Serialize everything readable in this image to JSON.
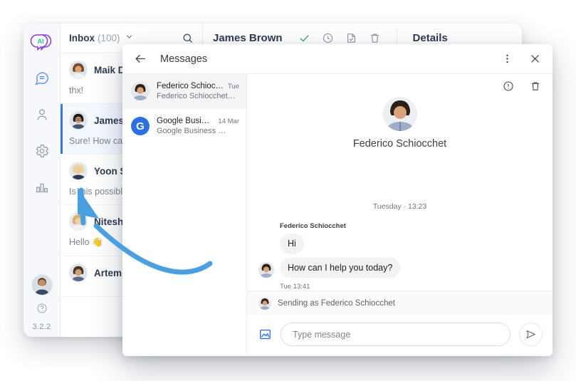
{
  "app": {
    "version_label": "3.2.2",
    "logo_text": "AI",
    "rail_items": [
      {
        "name": "conversations",
        "icon": "chat-icon"
      },
      {
        "name": "contacts",
        "icon": "person-icon"
      },
      {
        "name": "settings",
        "icon": "gear-icon"
      },
      {
        "name": "reports",
        "icon": "bar-chart-icon"
      }
    ]
  },
  "inbox": {
    "label": "Inbox",
    "count": "(100)",
    "search_icon": "search-icon",
    "chevron_icon": "chevron-down-icon",
    "conversations": [
      {
        "name": "Maik Da",
        "preview": "thx!"
      },
      {
        "name": "James B",
        "preview": "Sure! How can I h"
      },
      {
        "name": "Yoon Ss",
        "preview": "Is this possible?"
      },
      {
        "name": "Nitesh S",
        "preview": "Hello 👋"
      },
      {
        "name": "Artem P",
        "preview": ""
      }
    ]
  },
  "conversation_header": {
    "title": "James Brown",
    "details_label": "Details",
    "actions": [
      {
        "name": "resolve-check",
        "icon": "check-icon",
        "color": "#4eab6e"
      },
      {
        "name": "snooze",
        "icon": "clock-icon"
      },
      {
        "name": "archive",
        "icon": "archive-icon"
      },
      {
        "name": "delete",
        "icon": "trash-icon"
      }
    ]
  },
  "modal": {
    "title": "Messages",
    "back_icon": "arrow-left-icon",
    "kebab_icon": "more-vertical-icon",
    "close_icon": "close-icon",
    "toolbar": [
      {
        "name": "info",
        "icon": "info-circle-icon"
      },
      {
        "name": "delete-thread",
        "icon": "trash-icon"
      }
    ],
    "threads": [
      {
        "name": "Federico Schiocchet",
        "subtitle": "Federico Schiocchet…",
        "date": "Tue",
        "avatar": "photo",
        "active": true
      },
      {
        "name": "Google Business …",
        "subtitle": "Google Business …",
        "date": "14 Mar",
        "avatar": "G",
        "avatar_color": "#2b6fe0",
        "active": false
      }
    ],
    "chat": {
      "contact_name": "Federico Schiocchet",
      "day_separator": "Tuesday · 13:23",
      "sender_label": "Federico Schiocchet",
      "messages": [
        {
          "text": "Hi"
        },
        {
          "text": "How can I help you today?"
        }
      ],
      "message_time": "Tue 13:41"
    },
    "composer": {
      "sending_as": "Sending as Federico Schiocchet",
      "attach_icon": "image-icon",
      "input_value": "",
      "input_placeholder": "Type message",
      "send_icon": "send-icon"
    }
  },
  "annotation": {
    "type": "curved-arrow",
    "color": "#4a9fe0"
  }
}
